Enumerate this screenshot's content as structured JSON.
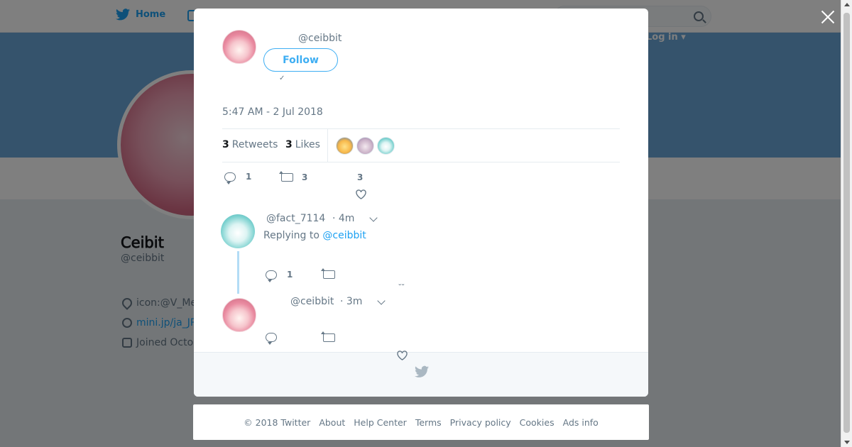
{
  "nav": {
    "home_label": "Home",
    "login_label": "Log in"
  },
  "profile": {
    "name": "𝖢𝖾𝗂𝖻𝗂𝗍",
    "handle": "@ceibbit",
    "location": "icon:@V_Me",
    "link": "mini.jp/ja_JP",
    "joined": "Joined Octo"
  },
  "tweet": {
    "handle": "@ceibbit",
    "follow_label": "Follow",
    "text": "",
    "timestamp": "5:47 AM - 2 Jul 2018",
    "retweets_count": "3",
    "retweets_label": "Retweets",
    "likes_count": "3",
    "likes_label": "Likes",
    "reply_count": "1",
    "retweet_count": "3",
    "like_count": "3"
  },
  "replies": [
    {
      "handle": "@fact_7114",
      "time": "· 4m",
      "replying_prefix": "Replying to",
      "replying_to": "@ceibbit",
      "reply_count": "1"
    },
    {
      "handle": "@ceibbit",
      "time": "· 3m"
    }
  ],
  "footer": {
    "links": [
      "© 2018 Twitter",
      "About",
      "Help Center",
      "Terms",
      "Privacy policy",
      "Cookies",
      "Ads info"
    ]
  },
  "colors": {
    "accent": "#1da1f2",
    "banner": "#6aa6d8",
    "overlay": "rgba(0,0,0,0.5)"
  },
  "icons": [
    "twitter-bird-icon",
    "search-icon",
    "close-icon",
    "reply-icon",
    "retweet-icon",
    "heart-icon",
    "chevron-down-icon",
    "location-icon",
    "link-icon",
    "calendar-icon"
  ]
}
